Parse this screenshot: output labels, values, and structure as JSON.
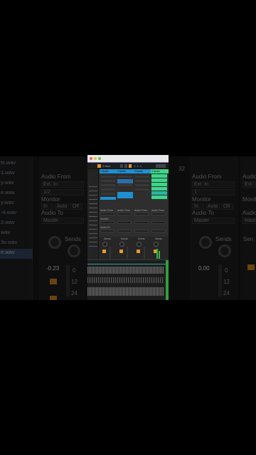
{
  "background_panel": {
    "browser_files": [
      "ts.wav",
      "1.wav",
      "y.wav",
      "e.wav",
      "y.wav",
      "-4.wav",
      "2.wav",
      "wav",
      "3s.wav",
      "e.wav"
    ],
    "selected_file_index": 9,
    "left_channel": {
      "audio_from_label": "Audio From",
      "audio_from_value": "Ext. In",
      "input_channel": "1/2",
      "monitor_label": "Monitor",
      "monitor_in": "In",
      "monitor_auto": "Auto",
      "monitor_off": "Off",
      "audio_to_label": "Audio To",
      "audio_to_value": "Master",
      "sends_label": "Sends",
      "volume_readout": "-0.23",
      "scale": [
        "0",
        "12",
        "24"
      ]
    },
    "right_channel": {
      "track_number": "32",
      "audio_from_label": "Audio From",
      "audio_from_value": "Ext. In",
      "input_channel": "1",
      "monitor_label": "Monitor",
      "monitor_in": "In",
      "monitor_auto": "Auto",
      "monitor_off": "Off",
      "audio_to_label": "Audio To",
      "audio_to_value": "Master",
      "sends_label": "Sends",
      "volume_readout": "0.00",
      "scale": [
        "0",
        "12",
        "24"
      ]
    },
    "far_right_channel": {
      "audio_from_label": "Audio",
      "audio_from_value": "Ext.",
      "monitor_label": "Monit",
      "audio_to_label": "Audio",
      "audio_to_value": "Maste",
      "sends_label": "Sen"
    }
  },
  "daw": {
    "transport_readouts": [
      "3 Bars",
      "1. 1. 1"
    ],
    "colors": {
      "accent_orange": "#e69a2e",
      "clip_blue": "#1f8fd0",
      "clip_green": "#3dd68a",
      "clip_teal": "#2bb5a0",
      "title_stripe": "#6d6fb1"
    },
    "tracks": [
      "1 Audio",
      "2 Audio",
      "3 Audio",
      "4 Audio"
    ],
    "io_labels": [
      "Audio From",
      "Ext. In",
      "Monitor",
      "Audio To",
      "Master"
    ],
    "mixer_labels": [
      "Sends",
      "Sends",
      "Sends",
      "Sends"
    ]
  }
}
